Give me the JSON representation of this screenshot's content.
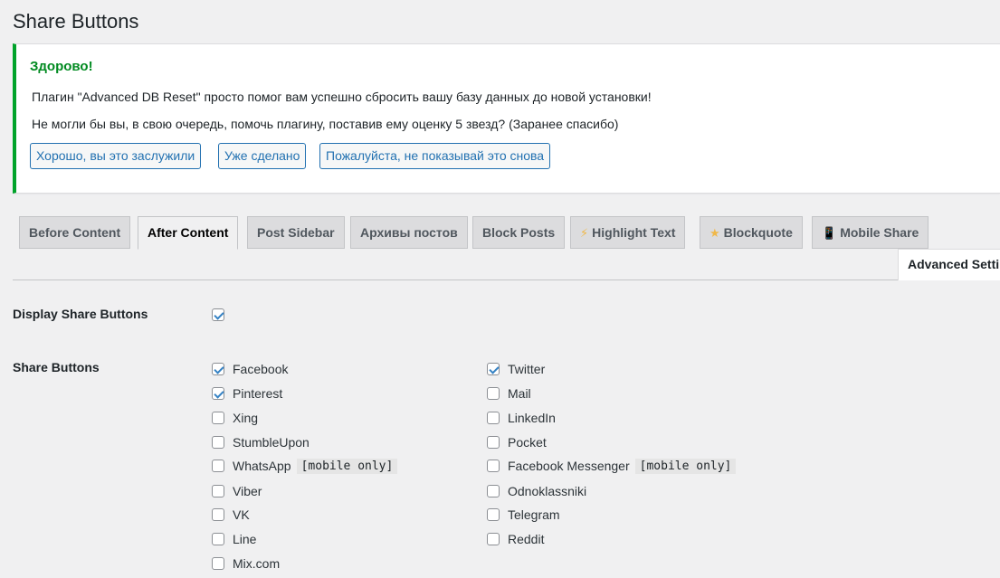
{
  "page": {
    "title": "Share Buttons"
  },
  "notice": {
    "heading": "Здорово!",
    "line1": "Плагин \"Advanced DB Reset\" просто помог вам успешно сбросить вашу базу данных до новой установки!",
    "line2": "Не могли бы вы, в свою очередь, помочь плагину, поставив ему оценку 5 звезд? (Заранее спасибо)",
    "buttons": [
      "Хорошо, вы это заслужили",
      "Уже сделано",
      "Пожалуйста, не показывай это снова"
    ],
    "accent_color": "#00a32a"
  },
  "tabs": [
    {
      "label": "Before Content",
      "icon": ""
    },
    {
      "label": "After Content",
      "icon": "",
      "active": true
    },
    {
      "label": "Post Sidebar",
      "icon": ""
    },
    {
      "label": "Архивы постов",
      "icon": ""
    },
    {
      "label": "Block Posts",
      "icon": ""
    },
    {
      "label": "Highlight Text",
      "icon": "⚡"
    },
    {
      "label": "Blockquote",
      "icon": "★"
    },
    {
      "label": "Mobile Share",
      "icon": "📱"
    }
  ],
  "advanced_tab": "Advanced Setti",
  "display": {
    "label": "Display Share Buttons",
    "checked": true
  },
  "share_buttons": {
    "label": "Share Buttons",
    "mobile_tag": "[mobile only]",
    "left": [
      {
        "name": "Facebook",
        "checked": true
      },
      {
        "name": "Pinterest",
        "checked": true
      },
      {
        "name": "Xing",
        "checked": false
      },
      {
        "name": "StumbleUpon",
        "checked": false
      },
      {
        "name": "WhatsApp",
        "checked": false,
        "mobile_only": true
      },
      {
        "name": "Viber",
        "checked": false
      },
      {
        "name": "VK",
        "checked": false
      },
      {
        "name": "Line",
        "checked": false
      },
      {
        "name": "Mix.com",
        "checked": false
      }
    ],
    "right": [
      {
        "name": "Twitter",
        "checked": true
      },
      {
        "name": "Mail",
        "checked": false
      },
      {
        "name": "LinkedIn",
        "checked": false
      },
      {
        "name": "Pocket",
        "checked": false
      },
      {
        "name": "Facebook Messenger",
        "checked": false,
        "mobile_only": true
      },
      {
        "name": "Odnoklassniki",
        "checked": false
      },
      {
        "name": "Telegram",
        "checked": false
      },
      {
        "name": "Reddit",
        "checked": false
      }
    ]
  }
}
